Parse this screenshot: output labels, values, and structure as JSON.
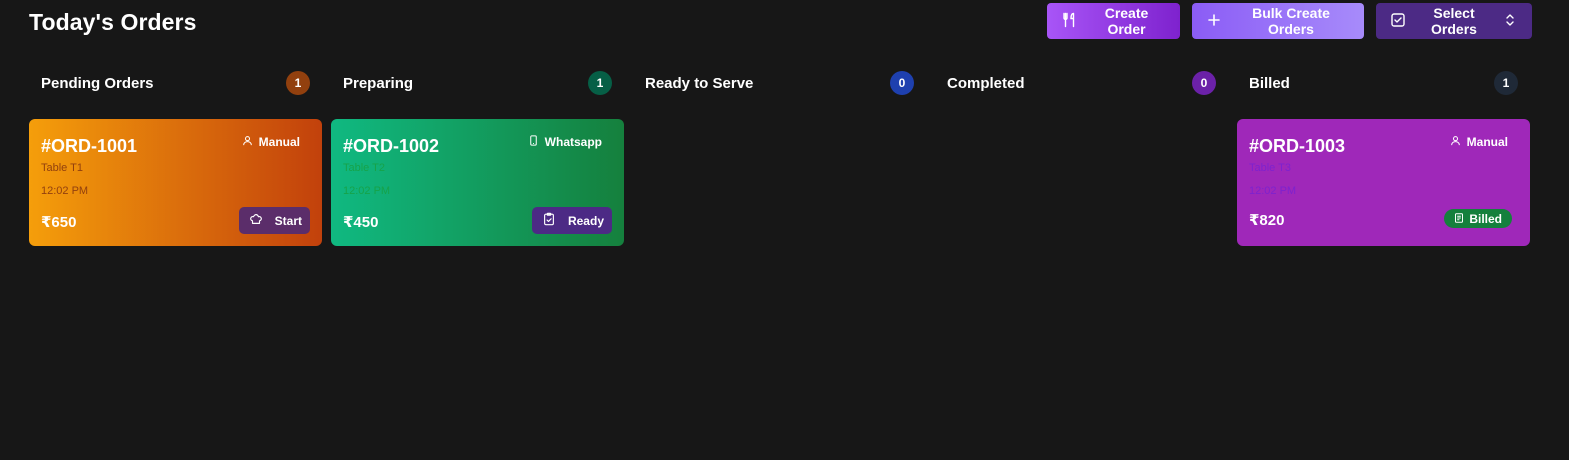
{
  "page": {
    "title": "Today's Orders",
    "background": "#171717"
  },
  "actions": {
    "create_order": "Create Order",
    "bulk_create": "Bulk Create Orders",
    "select_orders": "Select Orders"
  },
  "columns": [
    {
      "title": "Pending Orders",
      "count": "1",
      "badge_color": "#92400e"
    },
    {
      "title": "Preparing",
      "count": "1",
      "badge_color": "#065f46"
    },
    {
      "title": "Ready to Serve",
      "count": "0",
      "badge_color": "#1e40af"
    },
    {
      "title": "Completed",
      "count": "0",
      "badge_color": "#6b21a8"
    },
    {
      "title": "Billed",
      "count": "1",
      "badge_color": "#1f2937"
    }
  ],
  "cards": {
    "pending": {
      "id": "#ORD-1001",
      "source": "Manual",
      "table": "Table T1",
      "time": "12:02 PM",
      "price": "₹650",
      "action": "Start",
      "icon": "chef-hat-icon",
      "gradient": [
        "#f59e0b",
        "#c2410c"
      ],
      "action_color": "#5b2d6a",
      "sub_color": "#92400e"
    },
    "preparing": {
      "id": "#ORD-1002",
      "source": "Whatsapp",
      "table": "Table T2",
      "time": "12:02 PM",
      "price": "₹450",
      "action": "Ready",
      "icon": "clipboard-check-icon",
      "gradient": [
        "#10b981",
        "#15803d"
      ],
      "action_color": "#4c2a85",
      "sub_color": "#16a34a"
    },
    "billed": {
      "id": "#ORD-1003",
      "source": "Manual",
      "table": "Table T3",
      "time": "12:02 PM",
      "price": "₹820",
      "status": "Billed",
      "icon": "receipt-icon",
      "bg": "#9f28b9",
      "status_color": "#15803d",
      "sub_color": "#7e22ce"
    }
  }
}
